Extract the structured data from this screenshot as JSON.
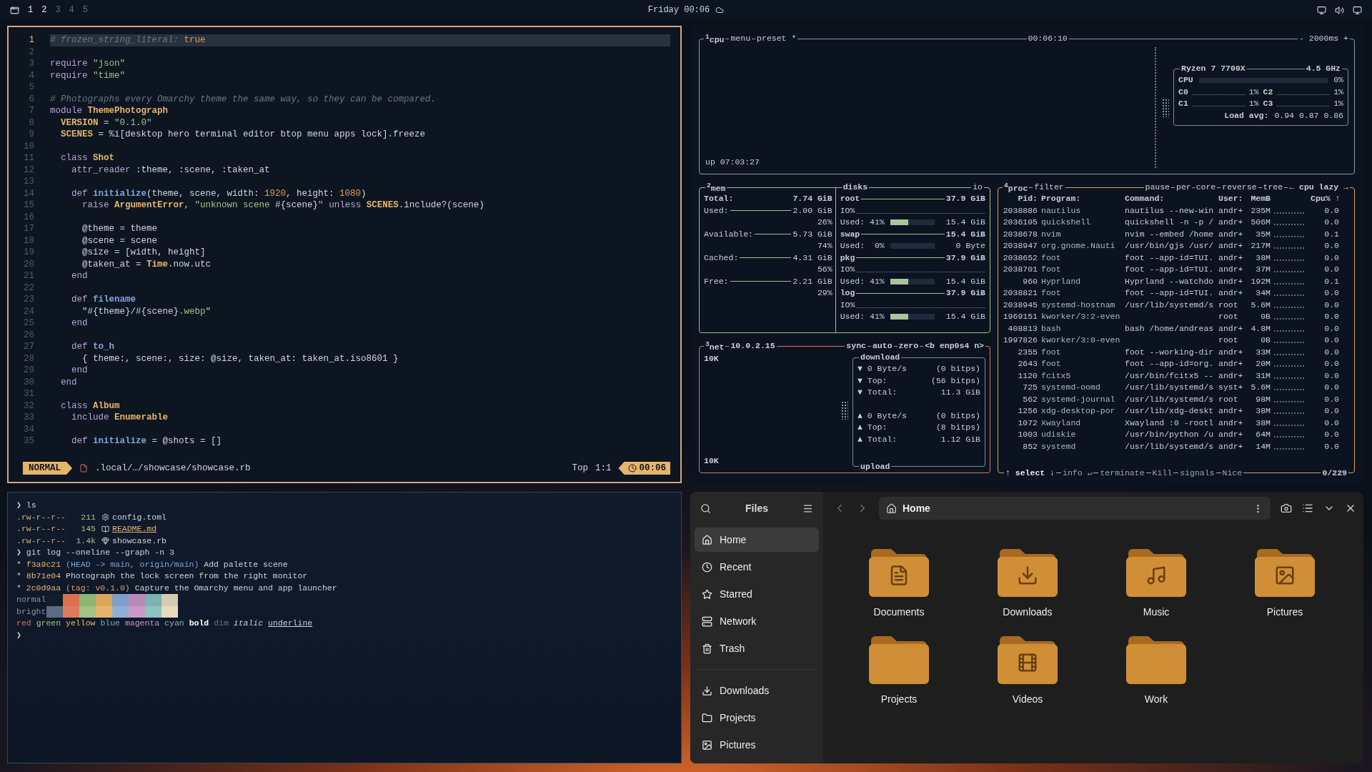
{
  "top_bar": {
    "workspaces": [
      {
        "label": "1",
        "occupied": true
      },
      {
        "label": "2",
        "occupied": true
      },
      {
        "label": "3",
        "occupied": false
      },
      {
        "label": "4",
        "occupied": false
      },
      {
        "label": "5",
        "occupied": false
      }
    ],
    "clock": "Friday 00:06"
  },
  "editor": {
    "lines": [
      {
        "number": "1",
        "current": true,
        "tokens": [
          {
            "kind": "com",
            "text": "# frozen_string_literal: "
          },
          {
            "kind": "num",
            "text": "true"
          }
        ]
      },
      {
        "number": "2",
        "current": false
      },
      {
        "number": "3",
        "current": false,
        "tokens": [
          {
            "kind": "kw",
            "text": "require "
          },
          {
            "kind": "str",
            "text": "\"json\""
          }
        ]
      },
      {
        "number": "4",
        "current": false,
        "tokens": [
          {
            "kind": "kw",
            "text": "require "
          },
          {
            "kind": "str",
            "text": "\"time\""
          }
        ]
      },
      {
        "number": "5",
        "current": false
      },
      {
        "number": "6",
        "current": false,
        "tokens": [
          {
            "kind": "com",
            "text": "# Photographs every Omarchy theme the same way, so they can be compared."
          }
        ]
      },
      {
        "number": "7",
        "current": false,
        "tokens": [
          {
            "kind": "kw",
            "text": "module "
          },
          {
            "kind": "const",
            "text": "ThemePhotograph"
          }
        ]
      },
      {
        "number": "8",
        "current": false,
        "tokens": [
          {
            "kind": "const",
            "text": "  VERSION"
          },
          {
            "kind": "p",
            "text": " = "
          },
          {
            "kind": "str",
            "text": "\"0.1.0\""
          }
        ]
      },
      {
        "number": "9",
        "current": false,
        "tokens": [
          {
            "kind": "const",
            "text": "  SCENES"
          },
          {
            "kind": "p",
            "text": " = %i[desktop hero terminal editor btop menu apps lock].freeze"
          }
        ]
      },
      {
        "number": "10",
        "current": false
      },
      {
        "number": "11",
        "current": false,
        "tokens": [
          {
            "kind": "kw",
            "text": "  class "
          },
          {
            "kind": "const",
            "text": "Shot"
          }
        ]
      },
      {
        "number": "12",
        "current": false,
        "tokens": [
          {
            "kind": "kw",
            "text": "    attr_reader "
          },
          {
            "kind": "p",
            "text": ":theme, :scene, :taken_at"
          }
        ]
      },
      {
        "number": "13",
        "current": false
      },
      {
        "number": "14",
        "current": false,
        "tokens": [
          {
            "kind": "kw",
            "text": "    def "
          },
          {
            "kind": "fn",
            "text": "initialize"
          },
          {
            "kind": "p",
            "text": "(theme, scene, width: "
          },
          {
            "kind": "num",
            "text": "1920"
          },
          {
            "kind": "p",
            "text": ", height: "
          },
          {
            "kind": "num",
            "text": "1080"
          },
          {
            "kind": "p",
            "text": ")"
          }
        ]
      },
      {
        "number": "15",
        "current": false,
        "tokens": [
          {
            "kind": "kw",
            "text": "      raise "
          },
          {
            "kind": "const",
            "text": "ArgumentError"
          },
          {
            "kind": "p",
            "text": ", "
          },
          {
            "kind": "str",
            "text": "\"unknown scene "
          },
          {
            "kind": "p",
            "text": "#{scene}"
          },
          {
            "kind": "str",
            "text": "\""
          },
          {
            "kind": "kw",
            "text": " unless "
          },
          {
            "kind": "const",
            "text": "SCENES"
          },
          {
            "kind": "p",
            "text": ".include?(scene)"
          }
        ]
      },
      {
        "number": "16",
        "current": false
      },
      {
        "number": "17",
        "current": false,
        "tokens": [
          {
            "kind": "p",
            "text": "      @theme = theme"
          }
        ]
      },
      {
        "number": "18",
        "current": false,
        "tokens": [
          {
            "kind": "p",
            "text": "      @scene = scene"
          }
        ]
      },
      {
        "number": "19",
        "current": false,
        "tokens": [
          {
            "kind": "p",
            "text": "      @size = [width, height]"
          }
        ]
      },
      {
        "number": "20",
        "current": false,
        "tokens": [
          {
            "kind": "p",
            "text": "      @taken_at = "
          },
          {
            "kind": "const",
            "text": "Time"
          },
          {
            "kind": "p",
            "text": ".now.utc"
          }
        ]
      },
      {
        "number": "21",
        "current": false,
        "tokens": [
          {
            "kind": "kw",
            "text": "    end"
          }
        ]
      },
      {
        "number": "22",
        "current": false
      },
      {
        "number": "23",
        "current": false,
        "tokens": [
          {
            "kind": "kw",
            "text": "    def "
          },
          {
            "kind": "fn",
            "text": "filename"
          }
        ]
      },
      {
        "number": "24",
        "current": false,
        "tokens": [
          {
            "kind": "p",
            "text": "      \"#{theme}/#{scene}"
          },
          {
            "kind": "str",
            "text": ".webp"
          },
          {
            "kind": "p",
            "text": "\""
          }
        ]
      },
      {
        "number": "25",
        "current": false,
        "tokens": [
          {
            "kind": "kw",
            "text": "    end"
          }
        ]
      },
      {
        "number": "26",
        "current": false
      },
      {
        "number": "27",
        "current": false,
        "tokens": [
          {
            "kind": "kw",
            "text": "    def "
          },
          {
            "kind": "fn",
            "text": "to_h"
          }
        ]
      },
      {
        "number": "28",
        "current": false,
        "tokens": [
          {
            "kind": "p",
            "text": "      { theme:, scene:, size: @size, taken_at: taken_at.iso8601 }"
          }
        ]
      },
      {
        "number": "29",
        "current": false,
        "tokens": [
          {
            "kind": "kw",
            "text": "    end"
          }
        ]
      },
      {
        "number": "30",
        "current": false,
        "tokens": [
          {
            "kind": "kw",
            "text": "  end"
          }
        ]
      },
      {
        "number": "31",
        "current": false
      },
      {
        "number": "32",
        "current": false,
        "tokens": [
          {
            "kind": "kw",
            "text": "  class "
          },
          {
            "kind": "const",
            "text": "Album"
          }
        ]
      },
      {
        "number": "33",
        "current": false,
        "tokens": [
          {
            "kind": "kw",
            "text": "    include "
          },
          {
            "kind": "const",
            "text": "Enumerable"
          }
        ]
      },
      {
        "number": "34",
        "current": false
      },
      {
        "number": "35",
        "current": false,
        "tokens": [
          {
            "kind": "kw",
            "text": "    def "
          },
          {
            "kind": "fn",
            "text": "initialize"
          },
          {
            "kind": "p",
            "text": " = @shots = []"
          }
        ]
      }
    ],
    "status": {
      "mode": "NORMAL",
      "file": ".local/…/showcase/showcase.rb",
      "position": "Top",
      "cursor": "1:1",
      "time": "00:06"
    }
  },
  "btop": {
    "cpu": {
      "title": "$^{1}$cpu",
      "menu": "menu",
      "preset": "preset *",
      "clock": "00:06:10",
      "interval": "- 2000ms +",
      "uptime": "up 07:03:27",
      "model": "Ryzen 7 7700X",
      "frequency": "4.5 GHz",
      "total": {
        "label": "CPU",
        "level": 0,
        "value": "0%"
      },
      "cores": [
        {
          "label": "C0",
          "value": "1%"
        },
        {
          "label": "C2",
          "value": "1%"
        },
        {
          "label": "C1",
          "value": "1%"
        },
        {
          "label": "C3",
          "value": "1%"
        }
      ],
      "load_label": "Load avg:",
      "load": "0.94 0.87 0.86"
    },
    "mem": {
      "title": "$^{2}$mem",
      "rows": [
        {
          "kind": "total",
          "label": "Total:",
          "value": "7.74 GiB"
        },
        {
          "kind": "stat",
          "label": "Used:",
          "value": "2.00 GiB",
          "percent": "26%"
        },
        {
          "kind": "stat",
          "label": "Available:",
          "value": "5.73 GiB",
          "percent": "74%"
        },
        {
          "kind": "stat",
          "label": "Cached:",
          "value": "4.31 GiB",
          "percent": "56%"
        },
        {
          "kind": "stat",
          "label": "Free:",
          "value": "2.21 GiB",
          "percent": "29%"
        }
      ]
    },
    "disks": {
      "title": "disks",
      "io": "io",
      "items": [
        {
          "name": "root",
          "size": "37.9 GiB",
          "io": "IO%",
          "used": "Used: 41%",
          "level": 0.41,
          "used_size": "15.4 GiB"
        },
        {
          "name": "swap",
          "size": "15.4 GiB",
          "used": "Used:  0%",
          "level": 0,
          "used_size": "0 Byte"
        },
        {
          "name": "pkg",
          "size": "37.9 GiB",
          "io": "IO%",
          "used": "Used: 41%",
          "level": 0.41,
          "used_size": "15.4 GiB"
        },
        {
          "name": "log",
          "size": "37.9 GiB",
          "io": "IO%",
          "used": "Used: 41%",
          "level": 0.41,
          "used_size": "15.4 GiB"
        }
      ]
    },
    "net": {
      "title": "$^{3}$net",
      "address": "10.0.2.15",
      "buttons": [
        "sync",
        "auto",
        "zero"
      ],
      "interface": "<b enp0s4 n>",
      "scale_top": "10K",
      "scale_bottom": "10K",
      "download": {
        "title": "download",
        "rows": [
          {
            "arrow": "▼",
            "label": "0 Byte/s",
            "value": "(0 bitps)"
          },
          {
            "arrow": "▼",
            "label": "Top:",
            "value": "(56 bitps)"
          },
          {
            "arrow": "▼",
            "label": "Total:",
            "value": "11.3 GiB"
          }
        ]
      },
      "upload": {
        "title": "upload",
        "rows": [
          {
            "arrow": "▲",
            "label": "0 Byte/s",
            "value": "(0 bitps)"
          },
          {
            "arrow": "▲",
            "label": "Top:",
            "value": "(8 bitps)"
          },
          {
            "arrow": "▲",
            "label": "Total:",
            "value": "1.12 GiB"
          }
        ]
      }
    },
    "proc": {
      "title": "$^{4}$proc",
      "filter": "filter",
      "options": [
        "pause",
        "per-core",
        "reverse",
        "tree"
      ],
      "sort": "← cpu lazy →",
      "columns": [
        "Pid:",
        "Program:",
        "Command:",
        "User:",
        "MemB",
        "Cpu% ↑"
      ],
      "rows": [
        {
          "pid": "2038886",
          "program": "nautilus",
          "command": "nautilus --new-win",
          "user": "andr+",
          "mem": "235M",
          "cpu": "0.0"
        },
        {
          "pid": "2036105",
          "program": "quickshell",
          "command": "quickshell -n -p /",
          "user": "andr+",
          "mem": "506M",
          "cpu": "0.0"
        },
        {
          "pid": "2038678",
          "program": "nvim",
          "command": "nvim --embed /home",
          "user": "andr+",
          "mem": "35M",
          "cpu": "0.1"
        },
        {
          "pid": "2038947",
          "program": "org.gnome.Nauti",
          "command": "/usr/bin/gjs /usr/",
          "user": "andr+",
          "mem": "217M",
          "cpu": "0.0"
        },
        {
          "pid": "2038652",
          "program": "foot",
          "command": "foot --app-id=TUI.",
          "user": "andr+",
          "mem": "38M",
          "cpu": "0.0"
        },
        {
          "pid": "2038701",
          "program": "foot",
          "command": "foot --app-id=TUI.",
          "user": "andr+",
          "mem": "37M",
          "cpu": "0.0"
        },
        {
          "pid": "960",
          "program": "Hyprland",
          "command": "Hyprland --watchdo",
          "user": "andr+",
          "mem": "192M",
          "cpu": "0.1"
        },
        {
          "pid": "2038821",
          "program": "foot",
          "command": "foot --app-id=TUI.",
          "user": "andr+",
          "mem": "34M",
          "cpu": "0.0"
        },
        {
          "pid": "2038945",
          "program": "systemd-hostnam",
          "command": "/usr/lib/systemd/s",
          "user": "root",
          "mem": "5.6M",
          "cpu": "0.0"
        },
        {
          "pid": "1969151",
          "program": "kworker/3:2-even",
          "user": "root",
          "mem": "0B",
          "cpu": "0.0"
        },
        {
          "pid": "408813",
          "program": "bash",
          "command": "bash /home/andreas",
          "user": "andr+",
          "mem": "4.8M",
          "cpu": "0.0"
        },
        {
          "pid": "1997826",
          "program": "kworker/3:0-even",
          "user": "root",
          "mem": "0B",
          "cpu": "0.0"
        },
        {
          "pid": "2355",
          "program": "foot",
          "command": "foot --working-dir",
          "user": "andr+",
          "mem": "33M",
          "cpu": "0.0"
        },
        {
          "pid": "2643",
          "program": "foot",
          "command": "foot --app-id=org.",
          "user": "andr+",
          "mem": "20M",
          "cpu": "0.0"
        },
        {
          "pid": "1120",
          "program": "fcitx5",
          "command": "/usr/bin/fcitx5 --",
          "user": "andr+",
          "mem": "31M",
          "cpu": "0.0"
        },
        {
          "pid": "725",
          "program": "systemd-oomd",
          "command": "/usr/lib/systemd/s",
          "user": "syst+",
          "mem": "5.6M",
          "cpu": "0.0"
        },
        {
          "pid": "562",
          "program": "systemd-journal",
          "command": "/usr/lib/systemd/s",
          "user": "root",
          "mem": "98M",
          "cpu": "0.0"
        },
        {
          "pid": "1256",
          "program": "xdg-desktop-por",
          "command": "/usr/lib/xdg-deskt",
          "user": "andr+",
          "mem": "38M",
          "cpu": "0.0"
        },
        {
          "pid": "1072",
          "program": "Xwayland",
          "command": "Xwayland :0 -rootl",
          "user": "andr+",
          "mem": "38M",
          "cpu": "0.0"
        },
        {
          "pid": "1003",
          "program": "udiskie",
          "command": "/usr/bin/python /u",
          "user": "andr+",
          "mem": "64M",
          "cpu": "0.0"
        },
        {
          "pid": "852",
          "program": "systemd",
          "command": "/usr/lib/systemd/s",
          "user": "andr+",
          "mem": "14M",
          "cpu": "0.0"
        }
      ],
      "footer": [
        "↑ select ↓",
        "info ↵",
        "terminate",
        "Kill",
        "signals",
        "Nice"
      ],
      "count": "0/229"
    }
  },
  "terminal": {
    "lines": [
      {
        "kind": "command",
        "prompt": "❯",
        "text": "ls"
      },
      {
        "kind": "config_file",
        "perms": ".rw-r--r--",
        "size": "211",
        "name": "config.toml"
      },
      {
        "kind": "markdown_file",
        "perms": ".rw-r--r--",
        "size": "145",
        "name": "README.md"
      },
      {
        "kind": "ruby_file",
        "perms": ".rw-r--r--",
        "size": "1.4k",
        "name": "showcase.rb"
      },
      {
        "kind": "command",
        "prompt": "❯",
        "text": "git log --oneline --graph -n 3"
      },
      {
        "kind": "commit",
        "graph": "*",
        "hash": "f3a9c21",
        "refs": "(HEAD -> main, origin/main)",
        "message": "Add palette scene"
      },
      {
        "kind": "commit",
        "graph": "*",
        "hash": "8b71e04",
        "message": "Photograph the lock screen from the right monitor"
      },
      {
        "kind": "tag_commit",
        "graph": "*",
        "hash": "2c0d9aa",
        "refs": "(tag: v0.1.0)",
        "message": "Capture the Omarchy menu and app launcher"
      },
      {
        "kind": "palette",
        "label": "normal",
        "swatches": [
          {
            "color": "#121c2b"
          },
          {
            "color": "#d9704f"
          },
          {
            "color": "#8fb573"
          },
          {
            "color": "#d9a75a"
          },
          {
            "color": "#7da0c9"
          },
          {
            "color": "#b88ab8"
          },
          {
            "color": "#7ab3b0"
          },
          {
            "color": "#d5cbb0"
          }
        ]
      },
      {
        "kind": "palette",
        "label": "bright",
        "swatches": [
          {
            "color": "#5a6b82"
          },
          {
            "color": "#e07a5f"
          },
          {
            "color": "#a3c386"
          },
          {
            "color": "#e5b36a"
          },
          {
            "color": "#8fb0d6"
          },
          {
            "color": "#c99ac6"
          },
          {
            "color": "#8ec4c0"
          },
          {
            "color": "#e8dcc0"
          }
        ]
      },
      {
        "kind": "styles",
        "words": [
          {
            "text": "red",
            "kind": "red"
          },
          {
            "text": "green",
            "kind": "green"
          },
          {
            "text": "yellow",
            "kind": "yellow"
          },
          {
            "text": "blue",
            "kind": "blue"
          },
          {
            "text": "magenta",
            "kind": "magenta"
          },
          {
            "text": "cyan",
            "kind": "cyan"
          },
          {
            "text": "bold",
            "kind": "bold"
          },
          {
            "text": "dim",
            "kind": "dim"
          },
          {
            "text": "italic",
            "kind": "italic"
          },
          {
            "text": "underline",
            "kind": "underline"
          }
        ]
      },
      {
        "kind": "prompt",
        "prompt": "❯"
      }
    ]
  },
  "files": {
    "title": "Files",
    "places": [
      {
        "label": "Home",
        "kind": "home",
        "selected": true
      },
      {
        "label": "Recent",
        "kind": "recent",
        "selected": false
      },
      {
        "label": "Starred",
        "kind": "starred",
        "selected": false
      },
      {
        "label": "Network",
        "kind": "network",
        "selected": false
      },
      {
        "label": "Trash",
        "kind": "trash",
        "selected": false
      }
    ],
    "bookmarks": [
      {
        "label": "Downloads",
        "kind": "downloads",
        "selected": false
      },
      {
        "label": "Projects",
        "kind": "folder",
        "selected": false
      },
      {
        "label": "Pictures",
        "kind": "pictures",
        "selected": false
      }
    ],
    "path": "Home",
    "folders": [
      {
        "label": "Documents",
        "kind": "documents"
      },
      {
        "label": "Downloads",
        "kind": "downloads"
      },
      {
        "label": "Music",
        "kind": "music"
      },
      {
        "label": "Pictures",
        "kind": "pictures"
      },
      {
        "label": "Projects",
        "kind": "plain"
      },
      {
        "label": "Videos",
        "kind": "videos"
      },
      {
        "label": "Work",
        "kind": "plain"
      }
    ]
  }
}
